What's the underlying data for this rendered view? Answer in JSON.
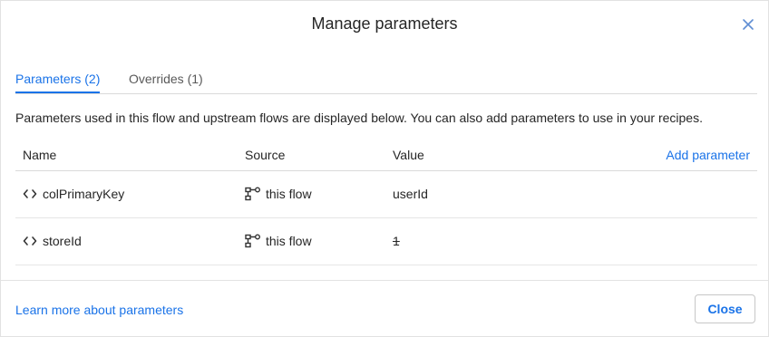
{
  "dialog": {
    "title": "Manage parameters",
    "close_icon": "close-icon"
  },
  "tabs": [
    {
      "label": "Parameters (2)",
      "active": true
    },
    {
      "label": "Overrides (1)",
      "active": false
    }
  ],
  "description": "Parameters used in this flow and upstream flows are displayed below. You can also add parameters to use in your recipes.",
  "table": {
    "columns": {
      "name": "Name",
      "source": "Source",
      "value": "Value"
    },
    "add_parameter_label": "Add parameter",
    "rows": [
      {
        "name": "colPrimaryKey",
        "name_icon": "code-brackets-icon",
        "source": "this flow",
        "source_icon": "flow-icon",
        "value": "userId",
        "value_struck": false
      },
      {
        "name": "storeId",
        "name_icon": "code-brackets-icon",
        "source": "this flow",
        "source_icon": "flow-icon",
        "value": "1",
        "value_struck": true
      }
    ]
  },
  "footer": {
    "learn_more": "Learn more about parameters",
    "close_label": "Close"
  },
  "colors": {
    "accent": "#1a73e8",
    "border": "#d9d9d9"
  }
}
